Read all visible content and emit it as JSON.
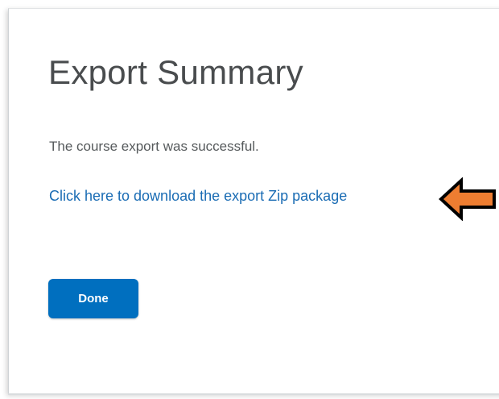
{
  "dialog": {
    "title": "Export Summary",
    "message": "The course export was successful.",
    "download_link_label": "Click here to download the export Zip package",
    "done_label": "Done"
  },
  "annotation": {
    "icon": "arrow-left-icon",
    "fill_color": "#ed7d31",
    "stroke_color": "#000000"
  },
  "colors": {
    "link": "#1a6cb4",
    "button": "#006fbf",
    "title": "#494c4e",
    "text": "#565a5c"
  }
}
